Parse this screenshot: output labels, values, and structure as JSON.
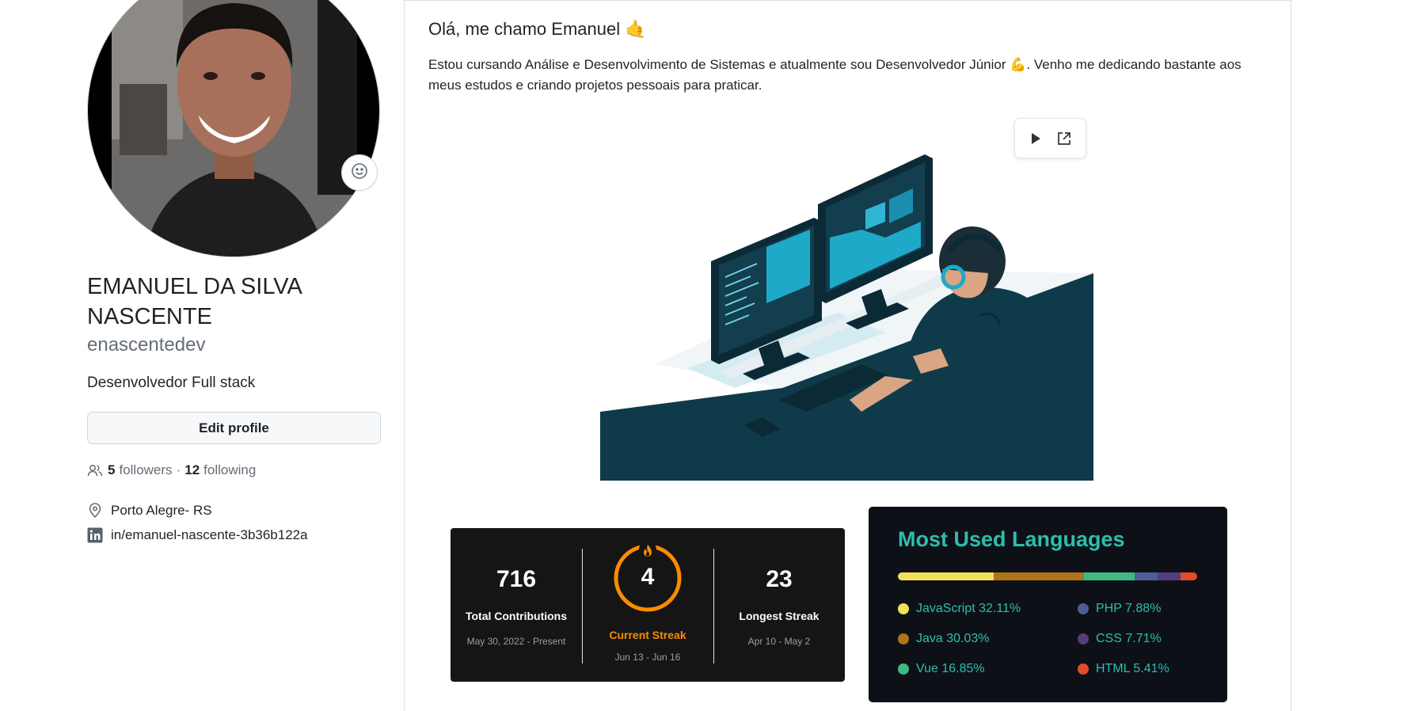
{
  "profile": {
    "full_name": "EMANUEL DA SILVA NASCENTE",
    "username": "enascentedev",
    "bio": "Desenvolvedor Full stack",
    "edit_button": "Edit profile",
    "followers_count": "5",
    "followers_label": "followers",
    "separator": "·",
    "following_count": "12",
    "following_label": "following",
    "location": "Porto Alegre- RS",
    "linkedin": "in/emanuel-nascente-3b36b122a"
  },
  "readme": {
    "title": "Olá, me chamo Emanuel 🤙",
    "paragraph": "Estou cursando Análise e Desenvolvimento de Sistemas e atualmente sou Desenvolvedor Júnior 💪. Venho me dedicando bastante aos meus estudos e criando projetos pessoais para praticar."
  },
  "streak": {
    "total_value": "716",
    "total_label": "Total Contributions",
    "total_range": "May 30, 2022 - Present",
    "current_value": "4",
    "current_label": "Current Streak",
    "current_range": "Jun 13 - Jun 16",
    "longest_value": "23",
    "longest_label": "Longest Streak",
    "longest_range": "Apr 10 - May 2",
    "accent_color": "#fb8c00"
  },
  "languages": {
    "title": "Most Used Languages",
    "items": [
      {
        "name": "JavaScript",
        "percent": 32.11,
        "label": "JavaScript 32.11%",
        "color": "#f1e05a"
      },
      {
        "name": "Java",
        "percent": 30.03,
        "label": "Java 30.03%",
        "color": "#b07219"
      },
      {
        "name": "Vue",
        "percent": 16.85,
        "label": "Vue 16.85%",
        "color": "#41b883"
      },
      {
        "name": "PHP",
        "percent": 7.88,
        "label": "PHP 7.88%",
        "color": "#4f5d95"
      },
      {
        "name": "CSS",
        "percent": 7.71,
        "label": "CSS 7.71%",
        "color": "#563d7c"
      },
      {
        "name": "HTML",
        "percent": 5.41,
        "label": "HTML 5.41%",
        "color": "#e34c26"
      }
    ]
  },
  "icons": [
    "smiley-icon",
    "people-icon",
    "location-icon",
    "linkedin-icon",
    "play-icon",
    "external-link-icon",
    "flame-icon"
  ]
}
